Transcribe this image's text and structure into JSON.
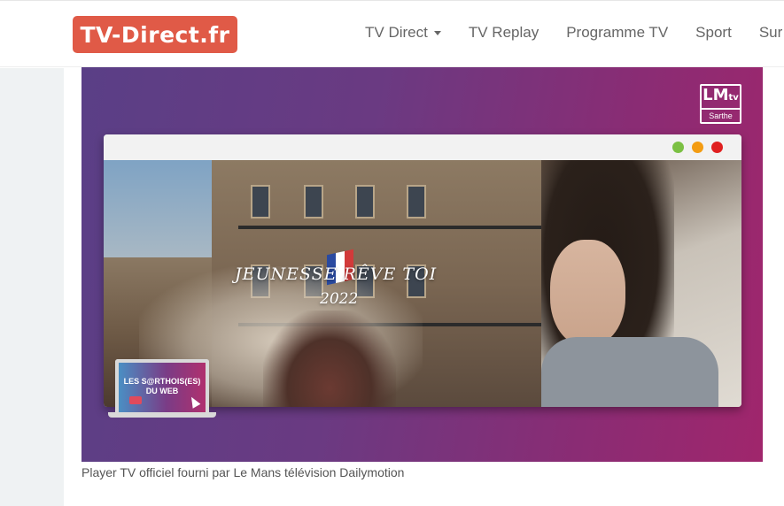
{
  "header": {
    "logo_text": "TV-Direct.fr",
    "nav": [
      {
        "label": "TV Direct",
        "has_dropdown": true
      },
      {
        "label": "TV Replay",
        "has_dropdown": false
      },
      {
        "label": "Programme TV",
        "has_dropdown": false
      },
      {
        "label": "Sport",
        "has_dropdown": false
      },
      {
        "label": "Sur",
        "has_dropdown": false
      }
    ]
  },
  "player": {
    "channel_badge": {
      "logo": "LM",
      "logo_suffix": "tv",
      "subtitle": "Sarthe"
    },
    "video_title": "JEUNESSE RÊVE TOI",
    "video_year": "2022",
    "laptop_text_line1": "LES S@RTHOIS(ES)",
    "laptop_text_line2": "DU WEB",
    "window_dots": [
      "#7bc043",
      "#f39c12",
      "#e02020"
    ]
  },
  "caption": "Player TV officiel fourni par Le Mans télévision Dailymotion",
  "colors": {
    "brand": "#e05a47",
    "nav_text": "#666666",
    "gutter": "#eff2f3"
  }
}
